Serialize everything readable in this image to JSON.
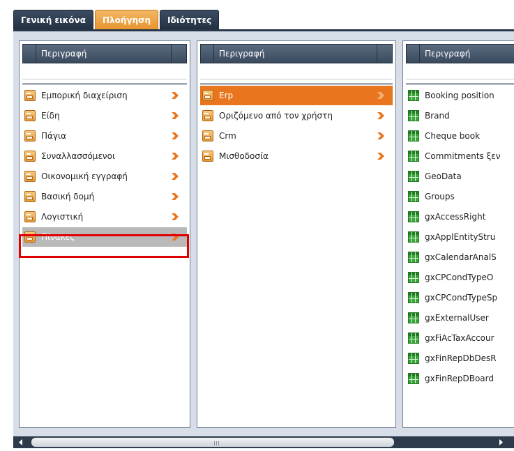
{
  "tabs": [
    {
      "label": "Γενική εικόνα",
      "active": false
    },
    {
      "label": "Πλοήγηση",
      "active": true
    },
    {
      "label": "Ιδιότητες",
      "active": false
    }
  ],
  "columns": [
    {
      "header": "Περιγραφή",
      "items": [
        {
          "label": "Εμπορική διαχείριση",
          "icon": "folder-icon",
          "selected": "none"
        },
        {
          "label": "Είδη",
          "icon": "folder-icon",
          "selected": "none"
        },
        {
          "label": "Πάγια",
          "icon": "folder-icon",
          "selected": "none"
        },
        {
          "label": "Συναλλασσόμενοι",
          "icon": "folder-icon",
          "selected": "none"
        },
        {
          "label": "Οικονομική εγγραφή",
          "icon": "folder-icon",
          "selected": "none"
        },
        {
          "label": "Βασική δομή",
          "icon": "folder-icon",
          "selected": "none"
        },
        {
          "label": "Λογιστική",
          "icon": "folder-icon",
          "selected": "none"
        },
        {
          "label": "Πίνακες",
          "icon": "folder-icon",
          "selected": "gray"
        }
      ]
    },
    {
      "header": "Περιγραφή",
      "items": [
        {
          "label": "Erp",
          "icon": "folder-icon",
          "selected": "orange"
        },
        {
          "label": "Οριζόμενο από τον χρήστη",
          "icon": "folder-icon",
          "selected": "none"
        },
        {
          "label": "Crm",
          "icon": "folder-icon",
          "selected": "none"
        },
        {
          "label": "Μισθοδοσία",
          "icon": "folder-icon",
          "selected": "none"
        }
      ]
    },
    {
      "header": "Περιγραφή",
      "items": [
        {
          "label": "Booking position",
          "icon": "table-icon"
        },
        {
          "label": "Brand",
          "icon": "table-icon"
        },
        {
          "label": "Cheque book",
          "icon": "table-icon"
        },
        {
          "label": "Commitments ξεν",
          "icon": "table-icon"
        },
        {
          "label": "GeoData",
          "icon": "table-icon"
        },
        {
          "label": "Groups",
          "icon": "table-icon"
        },
        {
          "label": "gxAccessRight",
          "icon": "table-icon"
        },
        {
          "label": "gxApplEntityStru",
          "icon": "table-icon"
        },
        {
          "label": "gxCalendarAnalS",
          "icon": "table-icon"
        },
        {
          "label": "gxCPCondTypeO",
          "icon": "table-icon"
        },
        {
          "label": "gxCPCondTypeSp",
          "icon": "table-icon"
        },
        {
          "label": "gxExternalUser",
          "icon": "table-icon"
        },
        {
          "label": "gxFiAcTaxAccour",
          "icon": "table-icon"
        },
        {
          "label": "gxFinRepDbDesR",
          "icon": "table-icon"
        },
        {
          "label": "gxFinRepDBoard",
          "icon": "table-icon"
        }
      ]
    }
  ],
  "colors": {
    "accent": "#e9751e",
    "selection_gray": "#b9b9b9",
    "highlight": "#e00000"
  }
}
